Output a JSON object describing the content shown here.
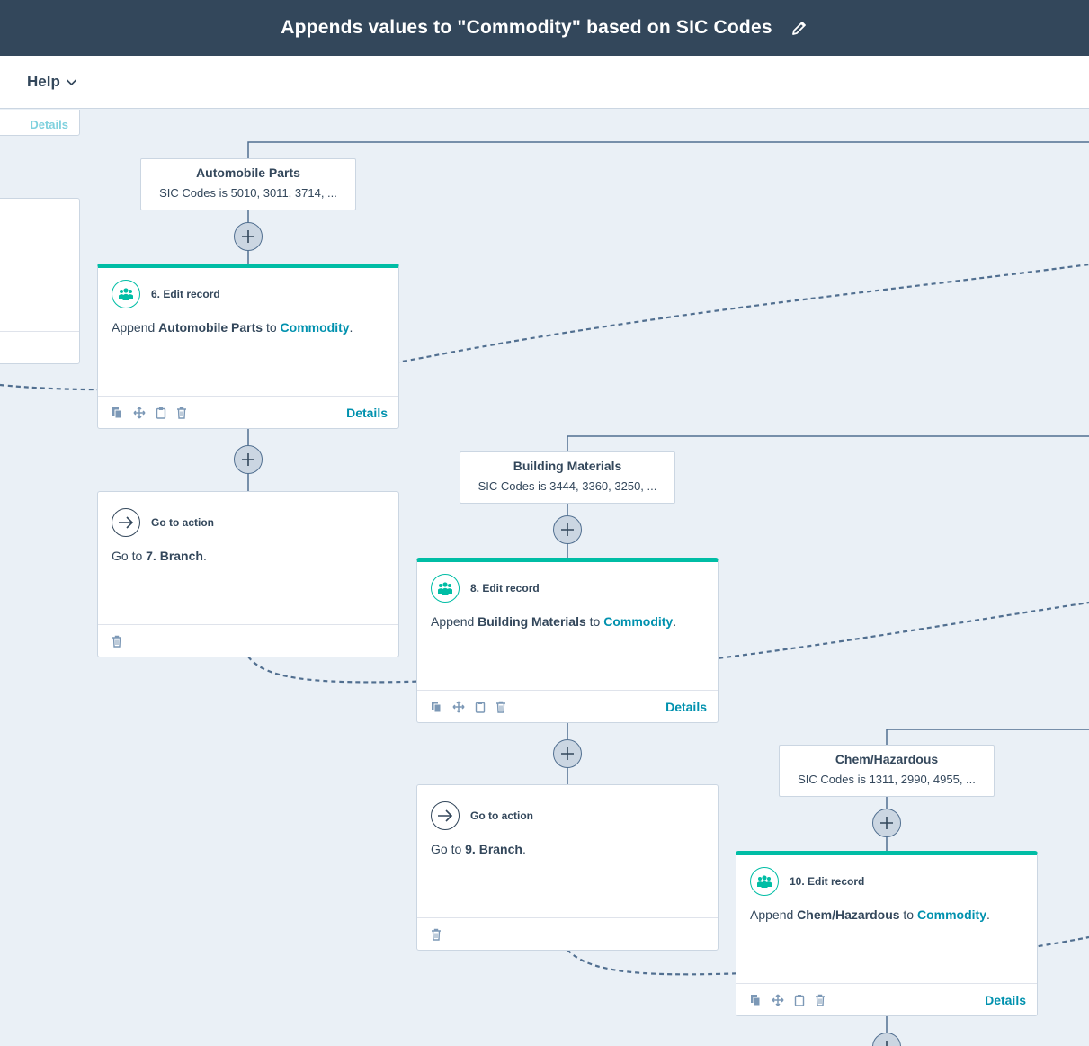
{
  "header": {
    "title": "Appends values to \"Commodity\" based on SIC Codes"
  },
  "menu": {
    "help_label": "Help"
  },
  "partial_card": {
    "details_label": "Details"
  },
  "branches": [
    {
      "name": "Automobile Parts",
      "condition": "SIC Codes is 5010, 3011, 3714, ..."
    },
    {
      "name": "Building Materials",
      "condition": "SIC Codes is 3444, 3360, 3250, ..."
    },
    {
      "name": "Chem/Hazardous",
      "condition": "SIC Codes is 1311, 2990, 4955, ..."
    }
  ],
  "edit_cards": [
    {
      "title": "6. Edit record",
      "prefix": "Append",
      "value": "Automobile Parts",
      "mid": "to",
      "property": "Commodity",
      "suffix": ".",
      "details_label": "Details"
    },
    {
      "title": "8. Edit record",
      "prefix": "Append",
      "value": "Building Materials",
      "mid": "to",
      "property": "Commodity",
      "suffix": ".",
      "details_label": "Details"
    },
    {
      "title": "10. Edit record",
      "prefix": "Append",
      "value": "Chem/Hazardous",
      "mid": "to",
      "property": "Commodity",
      "suffix": ".",
      "details_label": "Details"
    }
  ],
  "goto_cards": [
    {
      "title": "Go to action",
      "prefix": "Go to",
      "target": "7. Branch",
      "suffix": "."
    },
    {
      "title": "Go to action",
      "prefix": "Go to",
      "target": "9. Branch",
      "suffix": "."
    }
  ],
  "colors": {
    "header_bg": "#33475b",
    "canvas_bg": "#eaf0f6",
    "accent": "#00bda5",
    "link": "#0091ae",
    "connector": "#516f90"
  }
}
